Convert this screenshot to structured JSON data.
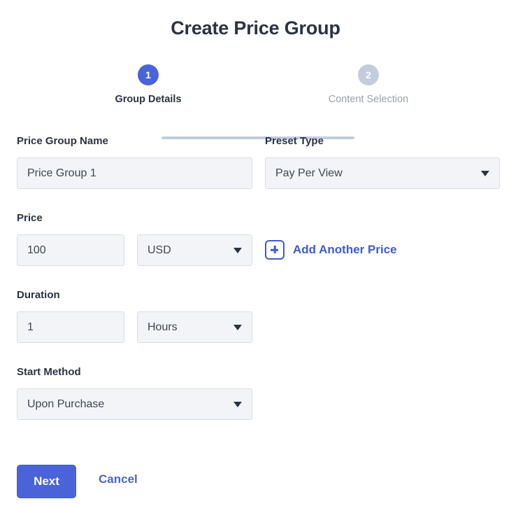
{
  "header": {
    "title": "Create Price Group"
  },
  "stepper": {
    "steps": [
      {
        "number": "1",
        "label": "Group Details",
        "state": "active"
      },
      {
        "number": "2",
        "label": "Content Selection",
        "state": "inactive"
      }
    ]
  },
  "form": {
    "price_group_name": {
      "label": "Price Group Name",
      "value": "Price Group 1",
      "placeholder": "Price Group 1"
    },
    "preset_type": {
      "label": "Preset Type",
      "value": "Pay Per View",
      "icon": "chevron-down-icon"
    },
    "price": {
      "label": "Price",
      "amount": "100",
      "currency": "USD",
      "currency_icon": "chevron-down-icon"
    },
    "add_another_price": {
      "label": "Add Another Price",
      "icon": "plus-square-icon"
    },
    "duration": {
      "label": "Duration",
      "amount": "1",
      "unit": "Hours",
      "unit_icon": "chevron-down-icon"
    },
    "start_method": {
      "label": "Start Method",
      "value": "Upon Purchase",
      "icon": "chevron-down-icon"
    }
  },
  "footer": {
    "next_label": "Next",
    "cancel_label": "Cancel"
  },
  "colors": {
    "accent": "#4a63d8",
    "link": "#3f5ad4",
    "inactive_step": "#c3ccdd",
    "field_bg": "#f2f4f8",
    "field_border": "#d8dce4",
    "text_primary": "#2b3244",
    "text_muted": "#9aa1ad"
  }
}
